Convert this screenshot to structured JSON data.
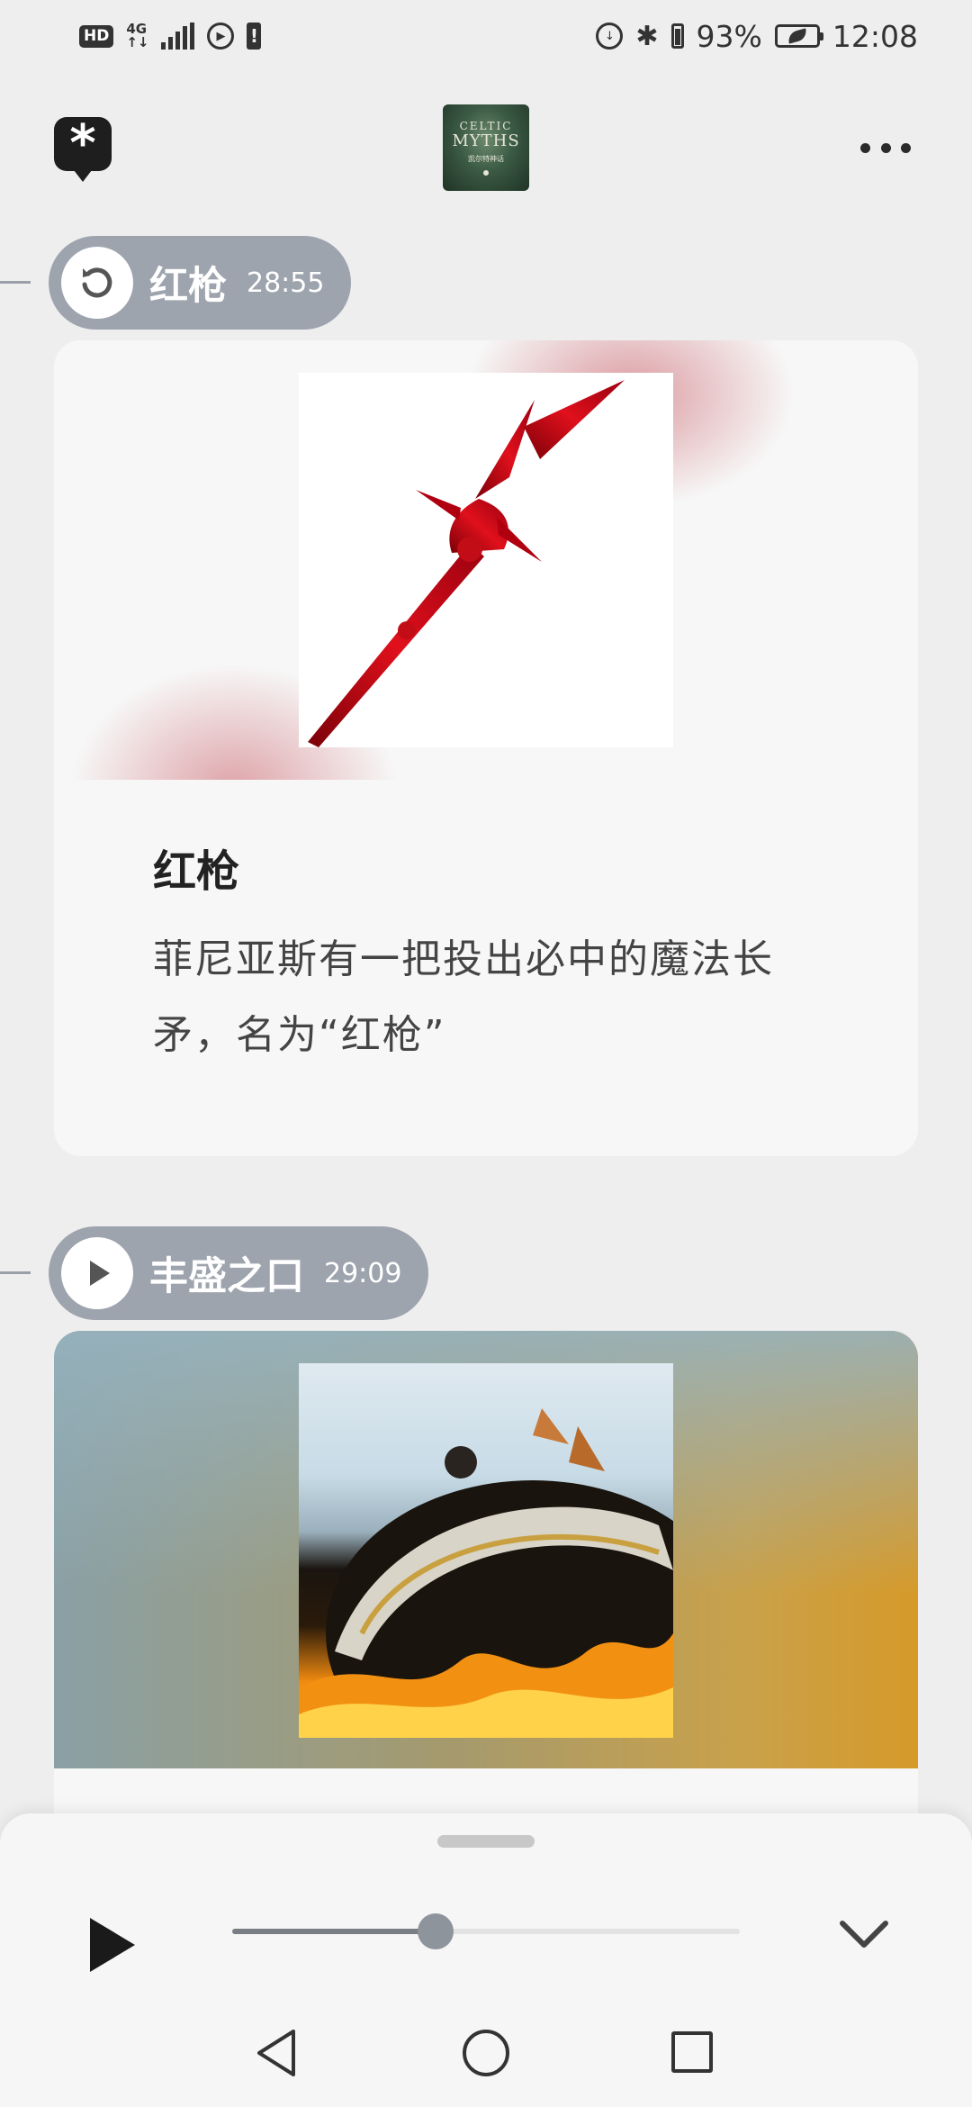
{
  "status_bar": {
    "hd": "HD",
    "network_top": "4G",
    "network_bottom": "↑↓",
    "battery_percent": "93%",
    "time": "12:08"
  },
  "header": {
    "logo_glyph": "*",
    "album_line1": "CELTIC",
    "album_line2": "MYTHS",
    "album_line3": "凯尔特神话"
  },
  "chapters": [
    {
      "title": "红枪",
      "time": "28:55",
      "icon": "replay-icon",
      "card_title": "红枪",
      "card_text": "菲尼亚斯有一把投出必中的魔法长矛，名为“红枪”"
    },
    {
      "title": "丰盛之口",
      "time": "29:09",
      "icon": "play-icon"
    }
  ],
  "player": {
    "progress": 0.4,
    "play_icon": "play-icon",
    "collapse_icon": "chevron-down-icon"
  },
  "colors": {
    "pill": "#9ea4ae",
    "background": "#eeeeee",
    "card": "#f7f7f7"
  }
}
